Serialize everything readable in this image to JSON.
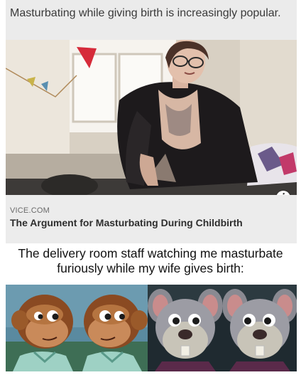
{
  "post": {
    "headline": "Masturbating while giving birth is increasingly popular."
  },
  "article": {
    "source": "VICE.COM",
    "title": "The Argument for Masturbating During Childbirth",
    "info_icon": "i"
  },
  "meme": {
    "caption": "The delivery room staff watching me masturbate furiously while my wife gives birth:"
  }
}
